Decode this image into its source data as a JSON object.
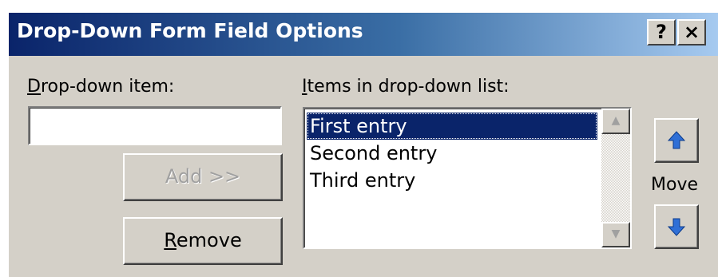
{
  "window": {
    "title": "Drop-Down Form Field Options",
    "help_label": "?",
    "close_label": "×"
  },
  "dropdown_item": {
    "label_mnemonic": "D",
    "label_rest": "rop-down item:",
    "value": ""
  },
  "buttons": {
    "add_label": "Add >>",
    "remove_mnemonic": "R",
    "remove_rest": "emove"
  },
  "list": {
    "label_mnemonic": "I",
    "label_rest": "tems in drop-down list:",
    "items": [
      "First entry",
      "Second entry",
      "Third entry"
    ],
    "selected_index": 0
  },
  "move": {
    "label": "Move",
    "up_icon": "arrow-up-icon",
    "down_icon": "arrow-down-icon",
    "arrow_color": "#2f6fd6"
  },
  "colors": {
    "title_bar_start": "#0a246a",
    "title_bar_end": "#a6caf0",
    "dialog_face": "#d4d0c8",
    "selection": "#0a246a"
  }
}
